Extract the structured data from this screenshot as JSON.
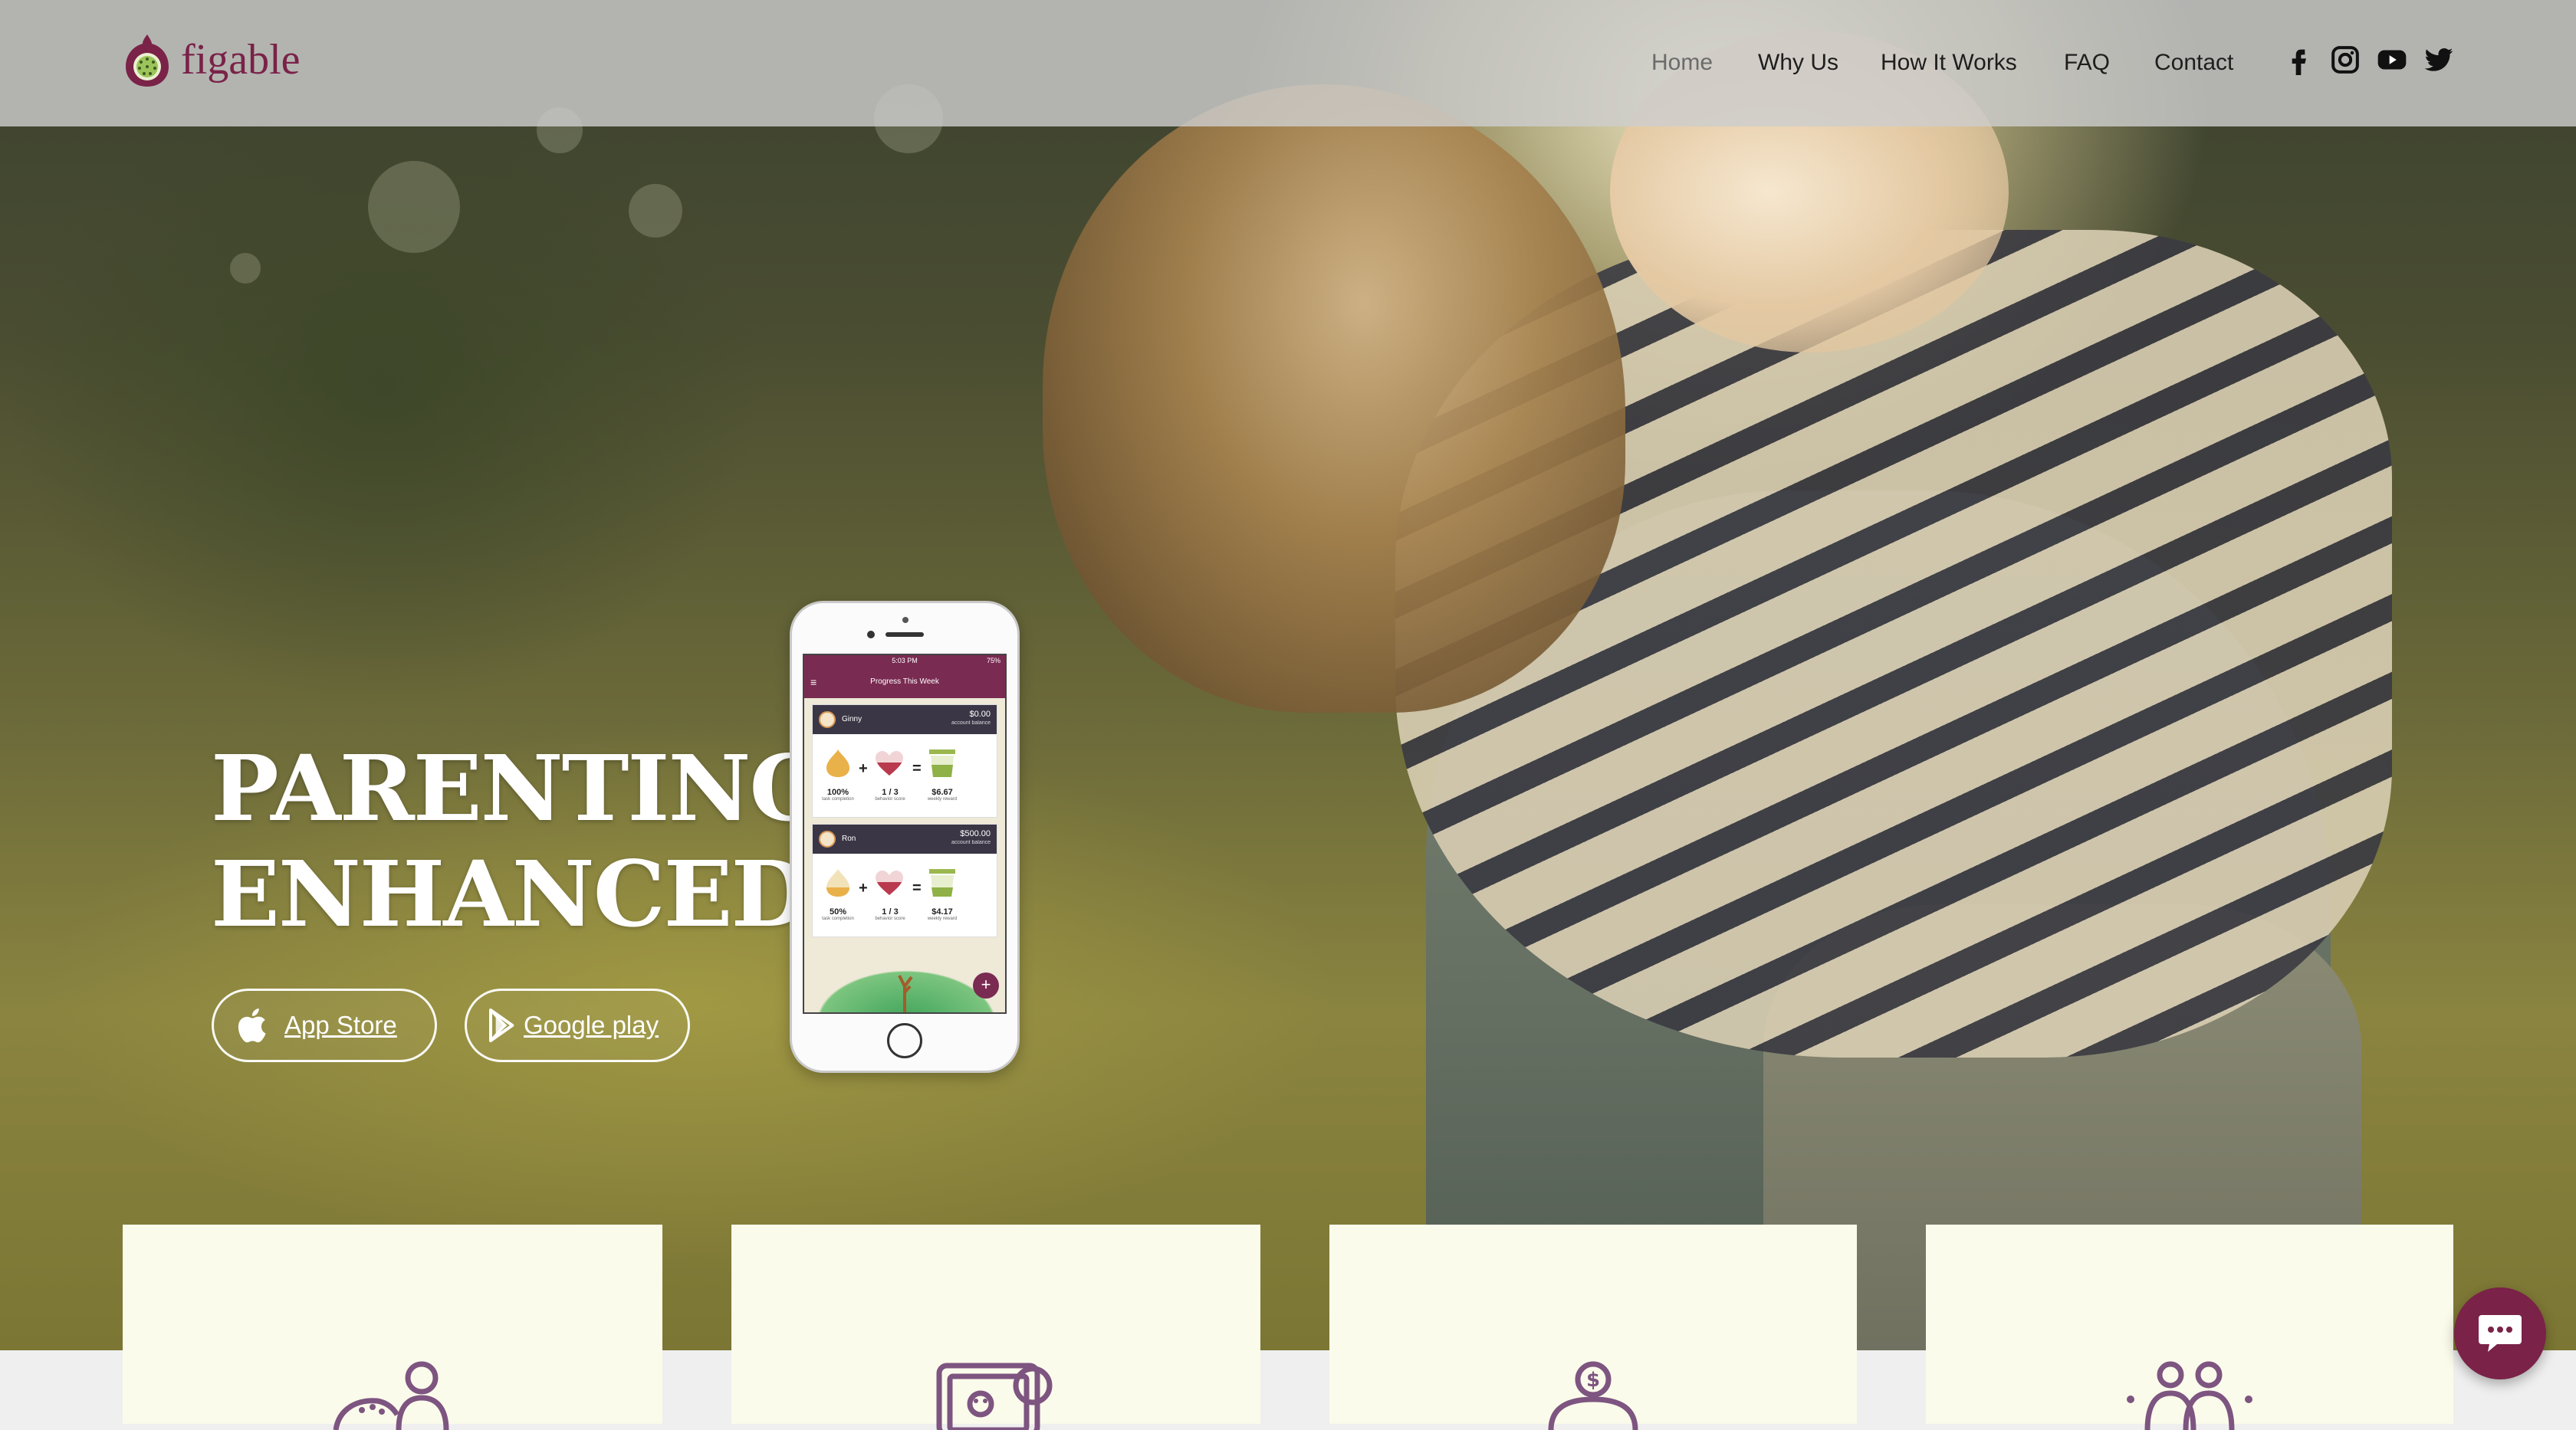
{
  "brand": {
    "name": "figable",
    "color": "#7a2248"
  },
  "nav": {
    "items": [
      {
        "label": "Home",
        "active": true
      },
      {
        "label": "Why Us",
        "active": false
      },
      {
        "label": "How It Works",
        "active": false
      },
      {
        "label": "FAQ",
        "active": false
      },
      {
        "label": "Contact",
        "active": false
      }
    ]
  },
  "social": [
    "facebook-icon",
    "instagram-icon",
    "youtube-icon",
    "twitter-icon"
  ],
  "hero": {
    "headline_line1": "PARENTING.",
    "headline_line2": "ENHANCED.",
    "app_store_label": "App Store",
    "google_play_label": "Google play"
  },
  "phone_screen": {
    "status_time": "5:03 PM",
    "status_battery": "75%",
    "title": "Progress This Week",
    "children": [
      {
        "name": "Ginny",
        "balance": "$0.00",
        "balance_label": "account balance",
        "task_completion": "100%",
        "task_label": "task completion",
        "behavior_score": "1 / 3",
        "behavior_label": "behavior score",
        "weekly_reward": "$6.67",
        "reward_label": "weekly reward"
      },
      {
        "name": "Ron",
        "balance": "$500.00",
        "balance_label": "account balance",
        "task_completion": "50%",
        "task_label": "task completion",
        "behavior_score": "1 / 3",
        "behavior_label": "behavior score",
        "weekly_reward": "$4.17",
        "reward_label": "weekly reward"
      }
    ],
    "fab_label": "+"
  },
  "features": [
    "parent-child-icon",
    "photo-video-icon",
    "money-bag-icon",
    "family-icon"
  ],
  "colors": {
    "accent": "#7a2248",
    "card_bg": "#fbfbeb",
    "header_bg": "#cdcdcd"
  }
}
